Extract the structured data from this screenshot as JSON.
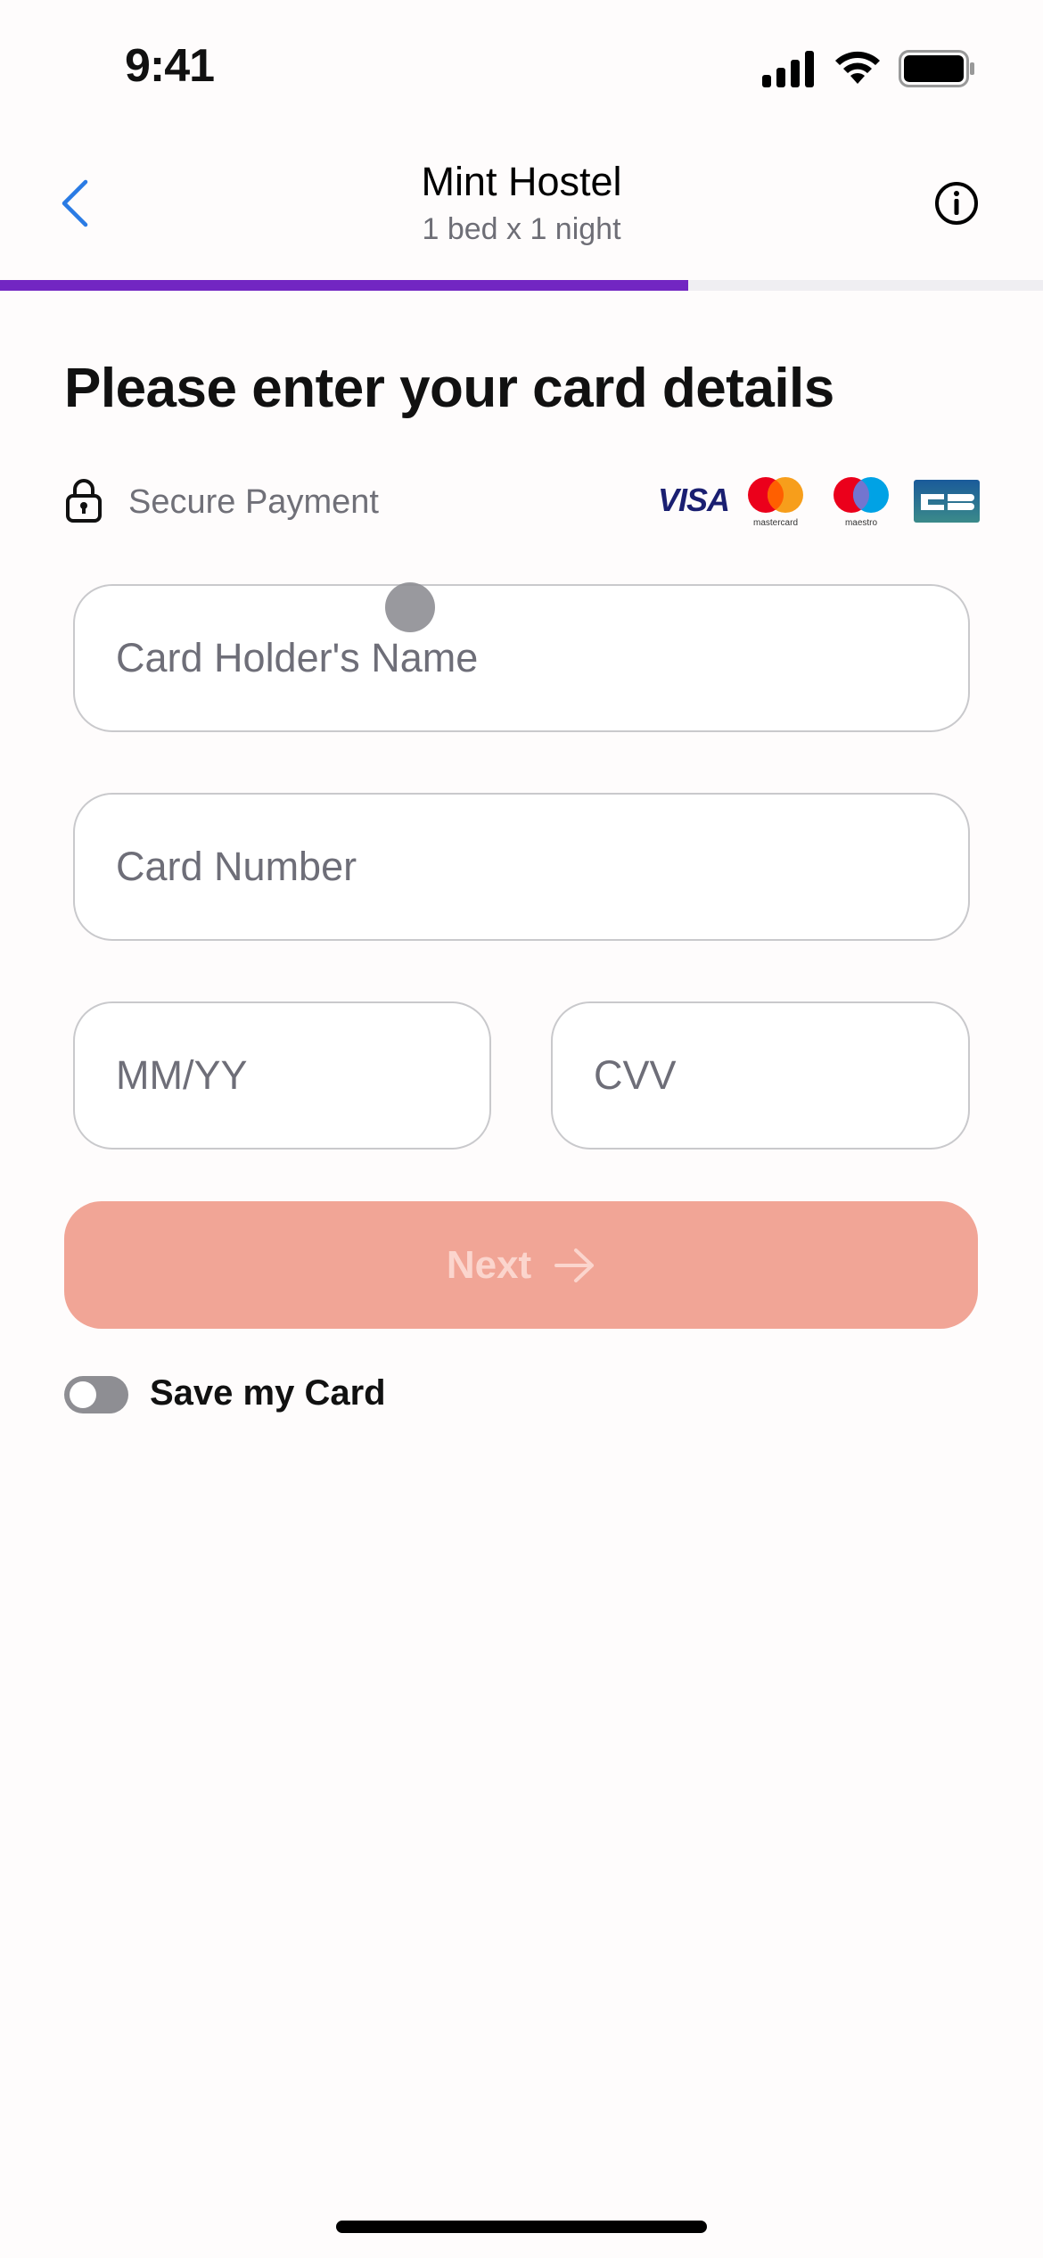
{
  "status_bar": {
    "time": "9:41",
    "icons": [
      "cellular-signal-icon",
      "wifi-icon",
      "battery-icon"
    ]
  },
  "nav": {
    "back_icon": "chevron-left-icon",
    "title": "Mint Hostel",
    "subtitle": "1 bed x 1 night",
    "info_icon": "info-circle-icon"
  },
  "progress": {
    "fraction": 0.66,
    "fill_color": "#7226c2",
    "track_color": "#efeef2"
  },
  "page": {
    "heading": "Please enter your card details",
    "secure_label": "Secure Payment",
    "secure_icon": "lock-icon",
    "card_brands": [
      "VISA",
      "mastercard",
      "maestro",
      "CB"
    ]
  },
  "form": {
    "card_holder": {
      "value": "",
      "placeholder": "Card Holder's Name"
    },
    "card_number": {
      "value": "",
      "placeholder": "Card Number"
    },
    "expiry": {
      "value": "",
      "placeholder": "MM/YY"
    },
    "cvv": {
      "value": "",
      "placeholder": "CVV"
    }
  },
  "actions": {
    "next_label": "Next",
    "next_icon": "arrow-right-icon",
    "next_color": "#f1a596",
    "next_enabled": false
  },
  "save_card": {
    "label": "Save my Card",
    "checked": false
  },
  "brands": {
    "mastercard_label": "mastercard",
    "maestro_label": "maestro",
    "visa_label": "VISA"
  }
}
